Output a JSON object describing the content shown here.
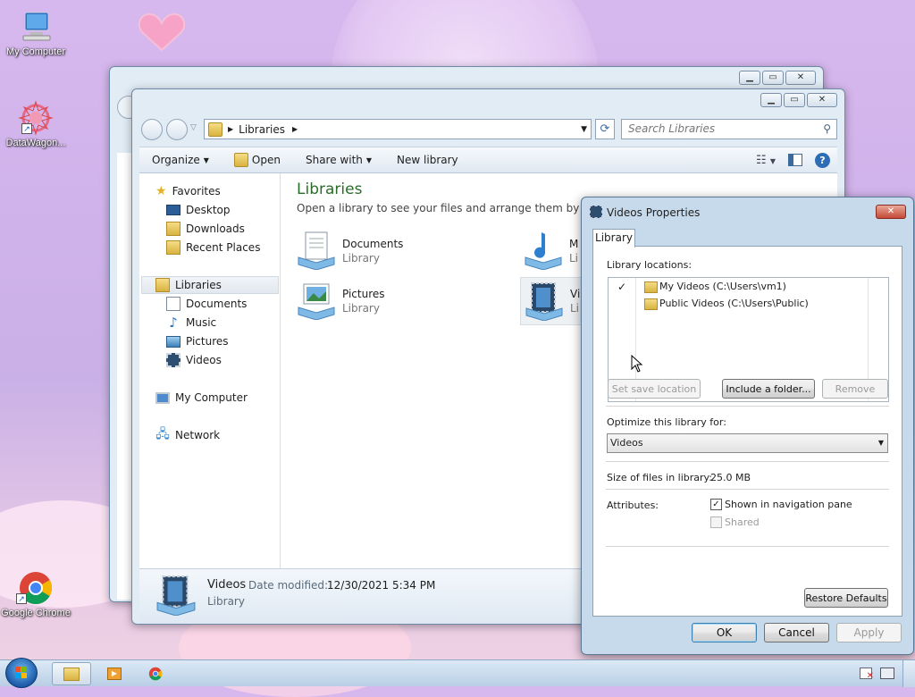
{
  "desktop": {
    "icons": [
      {
        "label": "My Computer",
        "icon": "computer-icon"
      },
      {
        "label": "DataWagon...",
        "icon": "datawagon-icon"
      },
      {
        "label": "Google Chrome",
        "icon": "chrome-icon"
      }
    ]
  },
  "explorer": {
    "address": {
      "crumb": "Libraries"
    },
    "search_placeholder": "Search Libraries",
    "toolbar": {
      "organize": "Organize",
      "open": "Open",
      "share_with": "Share with",
      "new_library": "New library"
    },
    "nav": {
      "favorites": "Favorites",
      "favorite_items": [
        "Desktop",
        "Downloads",
        "Recent Places"
      ],
      "libraries": "Libraries",
      "library_items": [
        "Documents",
        "Music",
        "Pictures",
        "Videos"
      ],
      "my_computer": "My Computer",
      "network": "Network"
    },
    "content": {
      "title": "Libraries",
      "subtitle": "Open a library to see your files and arrange them by folder, d",
      "items": [
        {
          "name": "Documents",
          "type": "Library"
        },
        {
          "name": "M",
          "type": "Li"
        },
        {
          "name": "Pictures",
          "type": "Library"
        },
        {
          "name": "Vi",
          "type": "Li"
        }
      ]
    },
    "details": {
      "name": "Videos",
      "modified_label": "Date modified:",
      "modified_value": "12/30/2021 5:34 PM",
      "type": "Library"
    }
  },
  "dialog": {
    "title": "Videos Properties",
    "tab": "Library",
    "locations_label": "Library locations:",
    "locations": [
      {
        "check": "✓",
        "name": "My Videos (C:\\Users\\vm1)"
      },
      {
        "check": "",
        "name": "Public Videos (C:\\Users\\Public)"
      }
    ],
    "buttons": {
      "set_save": "Set save location",
      "include": "Include a folder...",
      "remove": "Remove",
      "restore": "Restore Defaults",
      "ok": "OK",
      "cancel": "Cancel",
      "apply": "Apply"
    },
    "optimize_label": "Optimize this library for:",
    "optimize_value": "Videos",
    "size_label": "Size of files in library:",
    "size_value": "25.0 MB",
    "attributes_label": "Attributes:",
    "attr_shown": {
      "label": "Shown in navigation pane",
      "checked": true
    },
    "attr_shared": {
      "label": "Shared",
      "checked": false,
      "enabled": false
    }
  },
  "colors": {
    "accent_title": "#1e5fa0",
    "link_green": "#2a6d2a"
  }
}
